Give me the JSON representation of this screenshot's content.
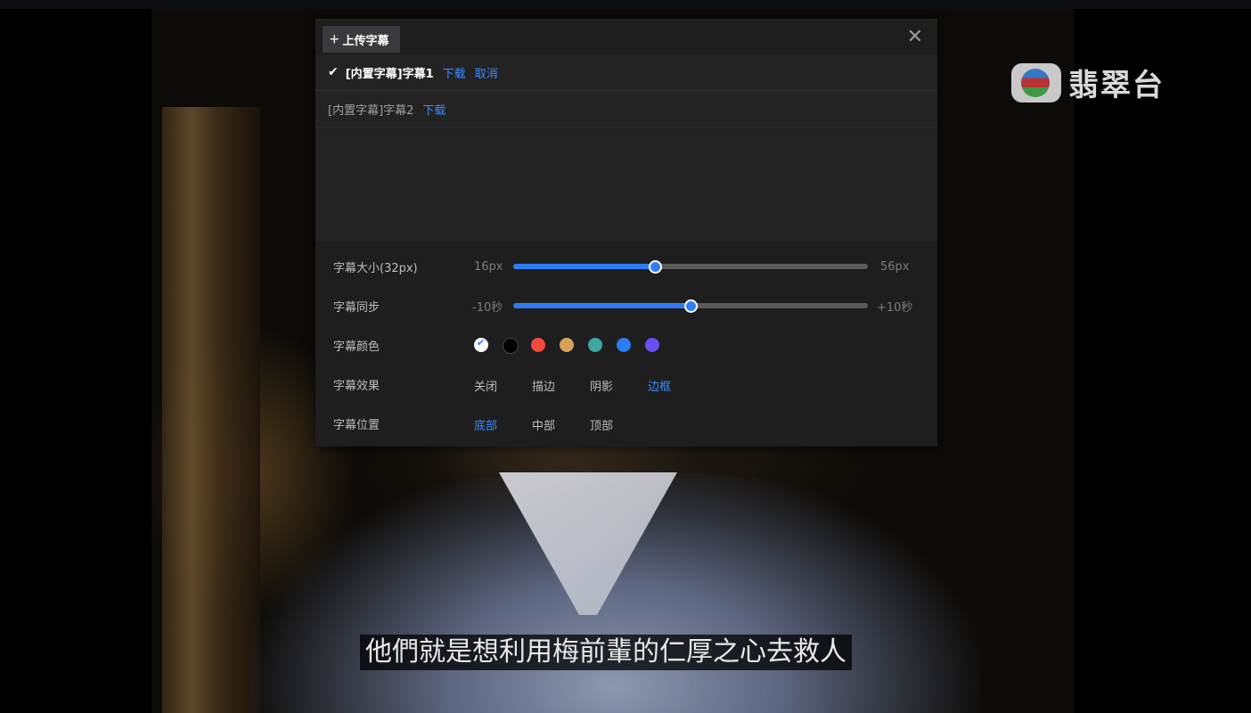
{
  "panel": {
    "upload_label": "上传字幕",
    "close_glyph": "✕"
  },
  "tracks": [
    {
      "label": "[内置字幕]字幕1",
      "active": true,
      "download": "下载",
      "cancel": "取消"
    },
    {
      "label": "[内置字幕]字幕2",
      "active": false,
      "download": "下载"
    }
  ],
  "settings": {
    "size": {
      "label": "字幕大小(32px)",
      "min": "16px",
      "max": "56px",
      "value": 0.4
    },
    "sync": {
      "label": "字幕同步",
      "min": "-10秒",
      "max": "+10秒",
      "value": 0.5
    },
    "color": {
      "label": "字幕颜色",
      "swatches": [
        "#ffffff",
        "#000000",
        "#f04a3d",
        "#d5a356",
        "#3da7a3",
        "#2d7cf5",
        "#6a4ef0"
      ],
      "selected": 0
    },
    "effect": {
      "label": "字幕效果",
      "options": [
        "关闭",
        "描边",
        "阴影",
        "边框"
      ],
      "selected": 3
    },
    "position": {
      "label": "字幕位置",
      "options": [
        "底部",
        "中部",
        "顶部"
      ],
      "selected": 0
    }
  },
  "video": {
    "logo_text": "翡翠台",
    "subtitle": "他們就是想利用梅前輩的仁厚之心去救人"
  }
}
